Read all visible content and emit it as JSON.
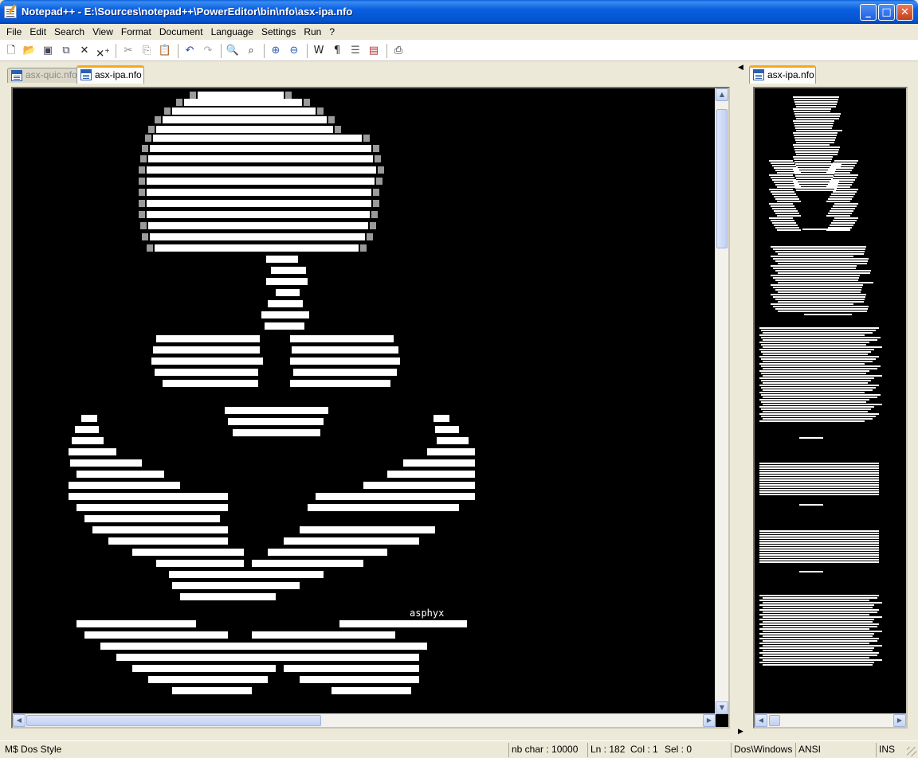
{
  "window": {
    "title": "Notepad++ - E:\\Sources\\notepad++\\PowerEditor\\bin\\nfo\\asx-ipa.nfo",
    "min_glyph": "_",
    "max_glyph": "□",
    "close_glyph": "✕"
  },
  "menu": [
    "File",
    "Edit",
    "Search",
    "View",
    "Format",
    "Document",
    "Language",
    "Settings",
    "Run",
    "?"
  ],
  "toolbar": {
    "icons": [
      "new-file",
      "open-file",
      "save",
      "save-all",
      "close",
      "close-all",
      "cut",
      "copy",
      "paste",
      "undo",
      "redo",
      "find",
      "replace",
      "zoom-in",
      "zoom-out",
      "wrap",
      "show-all-chars",
      "indent-guide",
      "user-defined-dialog",
      "print"
    ]
  },
  "left_pane": {
    "tabs": [
      {
        "label": "asx-quic.nfo",
        "active": false
      },
      {
        "label": "asx-ipa.nfo",
        "active": true
      }
    ],
    "signature": "asphyx",
    "vscroll_position": 0.03,
    "hscroll_position": 0.0
  },
  "right_pane": {
    "tabs": [
      {
        "label": "asx-ipa.nfo",
        "active": true
      }
    ]
  },
  "statusbar": {
    "style": "M$ Dos Style",
    "nb_char": "nb char : 10000",
    "ln": "Ln : 182",
    "col": "Col : 1",
    "sel": "Sel : 0",
    "eol": "Dos\\Windows",
    "encoding": "ANSI",
    "mode": "INS"
  },
  "colors": {
    "editor_bg": "#000000",
    "ascii_fg": "#ffffff",
    "tab_accent": "#f5a623",
    "titlebar": "#0a5fd8"
  }
}
